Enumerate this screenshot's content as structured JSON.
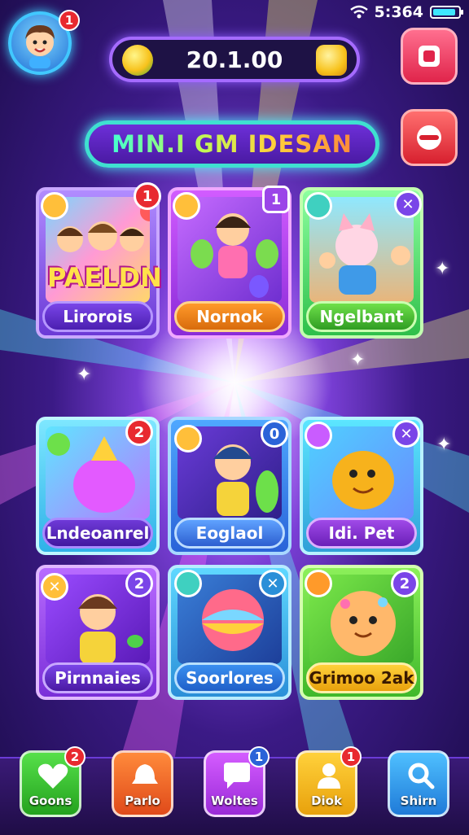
{
  "status": {
    "time": "5:364"
  },
  "profile": {
    "notifications": "1"
  },
  "currency": {
    "amount": "20.1.00"
  },
  "title": "MIN.I GM IDESAN",
  "cards": [
    {
      "banner": "PAELDN",
      "label": "Lirorois",
      "badge": "1"
    },
    {
      "label": "Nornok",
      "badge": "1"
    },
    {
      "label": "Ngelbant",
      "badge": "✕"
    },
    {
      "label": "Lndeoanrel",
      "badge": "2"
    },
    {
      "label": "Eoglaol",
      "badge": "0"
    },
    {
      "label": "Idi. Pet",
      "badge": "✕"
    },
    {
      "label": "Pirnnaies",
      "badge": "2"
    },
    {
      "label": "Soorlores",
      "badge": "✕"
    },
    {
      "label": "Grimoo 2ak",
      "badge": "2"
    }
  ],
  "nav": [
    {
      "label": "Goons",
      "badge": "2",
      "color": "#33c23f"
    },
    {
      "label": "Parlo",
      "badge": "",
      "color": "#f0642a"
    },
    {
      "label": "Woltes",
      "badge": "1",
      "color": "#c33fe8"
    },
    {
      "label": "Diok",
      "badge": "1",
      "color": "#f5b71c"
    },
    {
      "label": "Shirn",
      "badge": "",
      "color": "#2a9ef0"
    }
  ]
}
